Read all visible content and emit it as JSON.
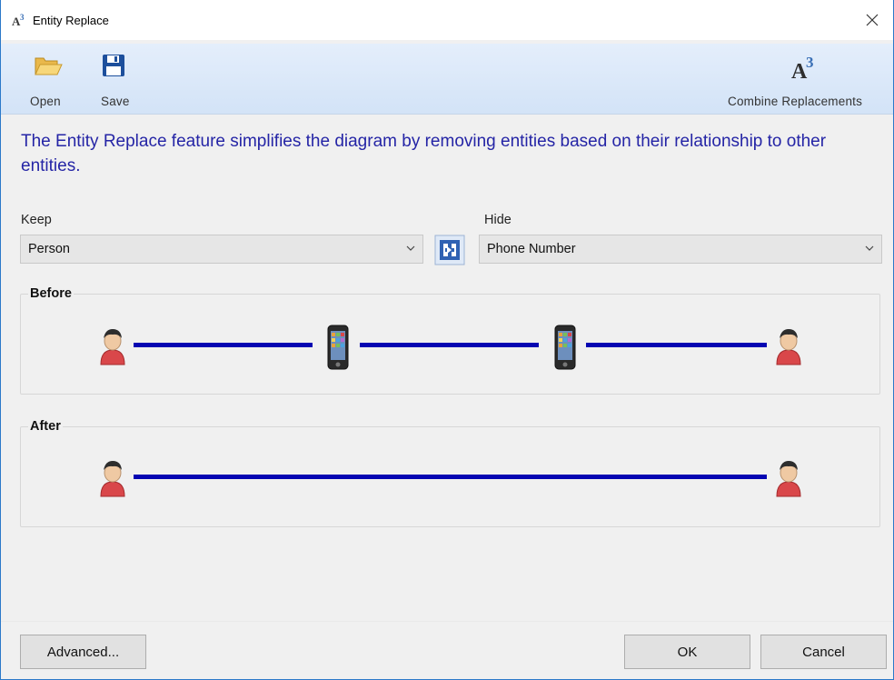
{
  "window": {
    "title": "Entity Replace",
    "title_icon_letter": "A",
    "title_icon_sup": "3"
  },
  "toolbar": {
    "open_label": "Open",
    "save_label": "Save",
    "combine_label": "Combine Replacements",
    "combine_icon_letter": "A",
    "combine_icon_sup": "3"
  },
  "description": "The Entity Replace feature simplifies the diagram by removing entities based on their relationship to other entities.",
  "keep": {
    "label": "Keep",
    "value": "Person"
  },
  "hide": {
    "label": "Hide",
    "value": "Phone Number"
  },
  "before": {
    "title": "Before",
    "entities": [
      "person-icon",
      "phone-icon",
      "phone-icon",
      "person-icon"
    ]
  },
  "after": {
    "title": "After",
    "entities": [
      "person-icon",
      "person-icon"
    ]
  },
  "buttons": {
    "advanced": "Advanced...",
    "ok": "OK",
    "cancel": "Cancel"
  },
  "colors": {
    "link_line": "#0505b2",
    "description_text": "#2525a6",
    "window_border": "#2b79c9"
  }
}
